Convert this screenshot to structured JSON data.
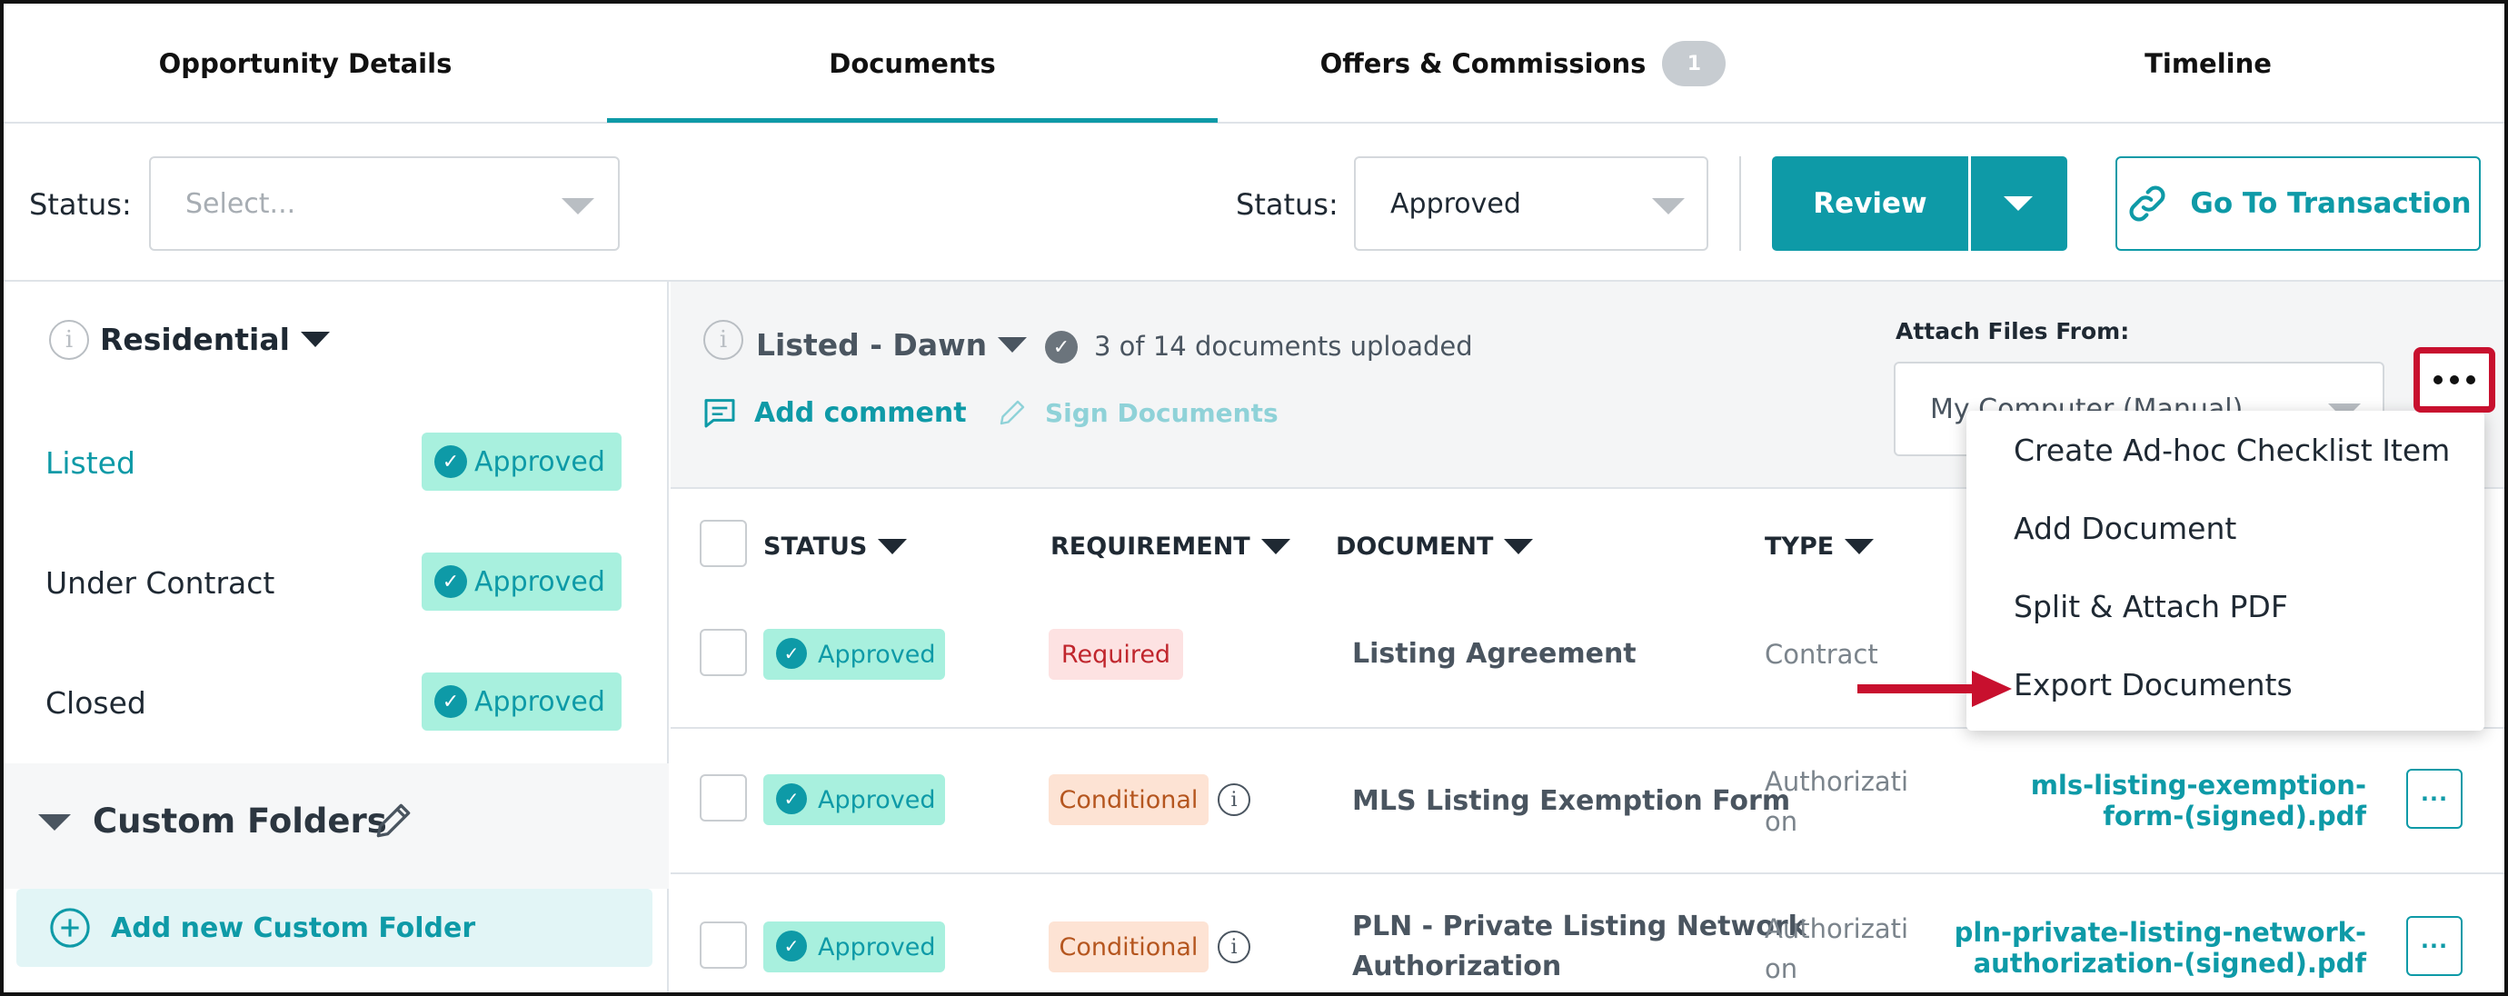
{
  "tabs": [
    {
      "label": "Opportunity Details"
    },
    {
      "label": "Documents"
    },
    {
      "label": "Offers & Commissions",
      "badge": "1"
    },
    {
      "label": "Timeline"
    }
  ],
  "filters": {
    "status1_label": "Status:",
    "status1_placeholder": "Select...",
    "status2_label": "Status:",
    "status2_value": "Approved",
    "review_label": "Review",
    "goto_label": "Go To Transaction"
  },
  "sidebar": {
    "group_title": "Residential",
    "items": [
      {
        "label": "Listed",
        "status": "Approved"
      },
      {
        "label": "Under Contract",
        "status": "Approved"
      },
      {
        "label": "Closed",
        "status": "Approved"
      }
    ],
    "custom_folders_label": "Custom Folders",
    "add_folder_label": "Add new Custom Folder"
  },
  "main": {
    "folder_title": "Listed - Dawn",
    "upload_status": "3 of 14 documents uploaded",
    "add_comment": "Add comment",
    "sign_documents": "Sign Documents",
    "attach_label": "Attach Files From:",
    "attach_value": "My Computer (Manual)"
  },
  "table": {
    "headers": [
      "STATUS",
      "REQUIREMENT",
      "DOCUMENT",
      "TYPE"
    ],
    "rows": [
      {
        "status": "Approved",
        "requirement": "Required",
        "document": "Listing Agreement",
        "type": "Contract",
        "file_1": "",
        "file_2": ""
      },
      {
        "status": "Approved",
        "requirement": "Conditional",
        "document": "MLS Listing Exemption Form",
        "type_1": "Authorizati",
        "type_2": "on",
        "file_1": "mls-listing-exemption-",
        "file_2": "form-(signed).pdf"
      },
      {
        "status": "Approved",
        "requirement": "Conditional",
        "document_1": "PLN - Private Listing Network",
        "document_2": "Authorization",
        "type_1": "Authorizati",
        "type_2": "on",
        "file_1": "pln-private-listing-network-",
        "file_2": "authorization-(signed).pdf"
      }
    ]
  },
  "menu": {
    "items": [
      "Create Ad-hoc Checklist Item",
      "Add Document",
      "Split & Attach PDF",
      "Export Documents"
    ]
  },
  "colors": {
    "accent": "#0e9aa7",
    "approved_bg": "#a8f0de",
    "highlight": "#c8102e"
  }
}
